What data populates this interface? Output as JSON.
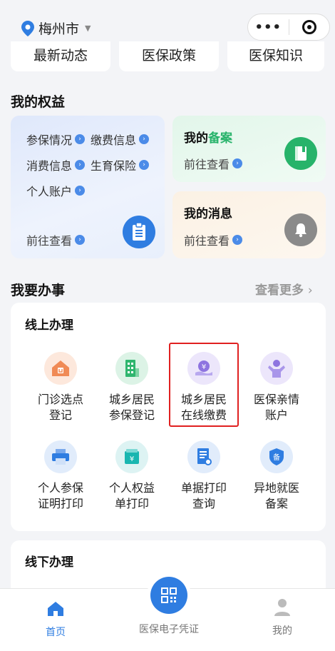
{
  "header": {
    "city": "梅州市"
  },
  "tabs": [
    "最新动态",
    "医保政策",
    "医保知识"
  ],
  "rights": {
    "title": "我的权益",
    "items": [
      "参保情况",
      "缴费信息",
      "消费信息",
      "生育保险",
      "个人账户"
    ],
    "goto": "前往查看",
    "record": {
      "title_prefix": "我的",
      "title_highlight": "备案",
      "goto": "前往查看"
    },
    "messages": {
      "title": "我的消息",
      "goto": "前往查看"
    }
  },
  "services": {
    "title": "我要办事",
    "more": "查看更多",
    "online_title": "线上办理",
    "items": [
      {
        "line1": "门诊选点",
        "line2": "登记",
        "icon": "house-icon"
      },
      {
        "line1": "城乡居民",
        "line2": "参保登记",
        "icon": "building-icon"
      },
      {
        "line1": "城乡居民",
        "line2": "在线缴费",
        "icon": "yuan-coin-icon"
      },
      {
        "line1": "医保亲情",
        "line2": "账户",
        "icon": "person-icon"
      },
      {
        "line1": "个人参保",
        "line2": "证明打印",
        "icon": "printer-icon"
      },
      {
        "line1": "个人权益",
        "line2": "单打印",
        "icon": "wallet-icon"
      },
      {
        "line1": "单据打印",
        "line2": "查询",
        "icon": "document-search-icon"
      },
      {
        "line1": "异地就医",
        "line2": "备案",
        "icon": "shield-icon"
      }
    ],
    "shield_char": "备",
    "offline_title": "线下办理"
  },
  "bottom_nav": {
    "home": "首页",
    "voucher": "医保电子凭证",
    "mine": "我的"
  },
  "colors": {
    "accent": "#2f7de1",
    "green": "#27b36a",
    "highlight_border": "#e02020"
  }
}
